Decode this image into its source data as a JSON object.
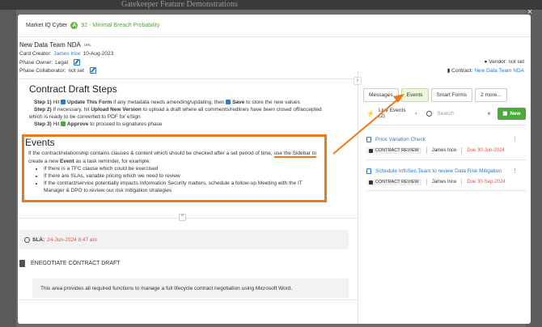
{
  "background": {
    "title": "Gatekeeper Feature Demonstrations"
  },
  "modal": {
    "close_icon": "×",
    "market": {
      "label": "Market IQ Cyber",
      "badge": "A",
      "risk_text": "92 - Minimal Breach Probability"
    },
    "card": {
      "title": "New Data Team NDA",
      "url_tag": "URL",
      "creator_label": "Card Creator:",
      "creator_name": "James Ince",
      "creator_date": "10-Aug-2023",
      "owner_label": "Phase Owner:",
      "owner_value": "Legal",
      "collaborator_label": "Phase Collaborator:",
      "collaborator_value": "not set",
      "vendor_label": "Vendor:",
      "vendor_value": "not set",
      "contract_label": "Contract:",
      "contract_value": "New Data Team NDA"
    },
    "steps": {
      "title": "Contract Draft Steps",
      "step1": {
        "prefix": "Step 1)",
        "text_a": " Hit ",
        "action_a": "Update This Form",
        "text_b": " if any metadata needs amending/updating, then ",
        "action_b": "Save",
        "text_c": " to store the new values"
      },
      "step2": {
        "prefix": "Step 2)",
        "text_a": " If necessary, hit ",
        "action_a": "Upload New Version",
        "text_b": " to upload a draft where all comments/redlines have been closed off/accepted",
        "line2": "which is ready to be converted to PDF for eSign"
      },
      "step3": {
        "prefix": "Step 3)",
        "text_a": " Hit ",
        "action_a": "Approve",
        "text_b": " to proceed to signatures phase"
      }
    },
    "events_section": {
      "title": "Events",
      "text_a": "If the contract/relationship contains clauses & content which should be checked after a set period of time, ",
      "text_link": "use the Sidebar to",
      "line2_a": "create a new ",
      "line2_b": "Event",
      "line2_c": " as a task reminder, for example:",
      "bullets": [
        "If there is a TFC clause which could be exercised",
        "If there are SLAs, variable pricing which we need to review",
        "If the contract/service potentially impacts Information Security matters, schedule a follow-up Meeting with the IT",
        "Manager & DPO to review our risk mitigation strategies"
      ]
    },
    "collapse_icon": "^",
    "sla": {
      "label": "SLA:",
      "value": "24-Jun-2024 8:47 am"
    },
    "negotiate": {
      "title": "ENEGOTIATE CONTRACT DRAFT",
      "description": "This area provides all required functions to manage a full lifecycle contract negotiation using Microsoft Word."
    },
    "side_toggle": "›"
  },
  "sidebar": {
    "tabs": [
      {
        "label": "Messages",
        "active": false
      },
      {
        "label": "Events",
        "active": true
      },
      {
        "label": "Smart Forms",
        "active": false
      },
      {
        "label": "2 more...",
        "active": false
      }
    ],
    "live_events": "Live Events (2)",
    "live_chevron": "›",
    "search": {
      "placeholder": "Search",
      "value": ""
    },
    "clear_icon": "×",
    "new_button": "New",
    "events": [
      {
        "title": "Price Variation Check",
        "tag": "CONTRACT REVIEW",
        "owner": "James Ince",
        "due": "Due 30-Jun-2024",
        "kebab": "⋮"
      },
      {
        "title": "Schedule InfoSec Team to review Data Risk Mitigation",
        "tag": "CONTRACT REVIEW",
        "owner": "James Ince",
        "due": "Due 30-Sep-2024",
        "kebab": "⋮"
      }
    ]
  },
  "colors": {
    "accent_orange": "#f07818",
    "link_blue": "#2a7cc7",
    "success_green": "#4caa3a",
    "due_red": "#d9534f"
  }
}
